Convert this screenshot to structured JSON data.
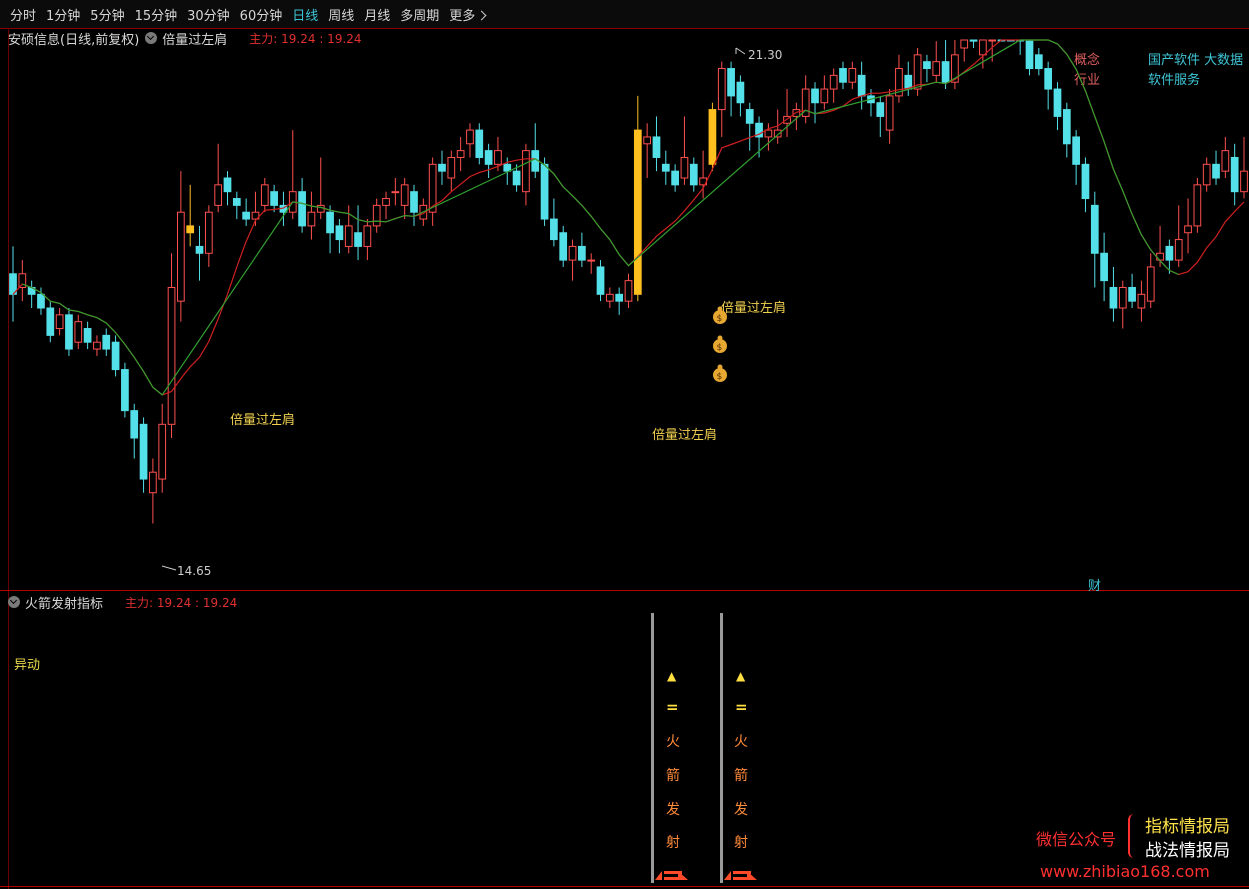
{
  "toolbar": {
    "tabs": [
      "分时",
      "1分钟",
      "5分钟",
      "15分钟",
      "30分钟",
      "60分钟",
      "日线",
      "周线",
      "月线",
      "多周期",
      "更多"
    ],
    "active_tab": "日线"
  },
  "header": {
    "stock": "安硕信息(日线,前复权)",
    "indicator": "倍量过左肩",
    "main_force": "主力: 19.24 : 19.24"
  },
  "info": {
    "concept_label": "概念",
    "concept_value": "国产软件 大数据 ",
    "industry_label": "行业",
    "industry_value": "软件服务"
  },
  "chart_labels": {
    "high": "21.30",
    "low": "14.65",
    "signal": "倍量过左肩",
    "cai": "财"
  },
  "sub": {
    "indicator": "火箭发射指标",
    "main_force": "主力: 19.24 : 19.24",
    "yidong": "异动",
    "rocket_chars": [
      "▲",
      "=",
      "火",
      "箭",
      "发",
      "射"
    ]
  },
  "watermark": {
    "wechat": "微信公众号",
    "brand1": "指标情报局",
    "brand2": "战法情报局",
    "url": "www.zhibiao168.com"
  },
  "colors": {
    "up": "#ff5050",
    "down": "#54e0e8",
    "ma_red": "#d02020",
    "ma_green": "#30a030",
    "signal_bar": "#ffc020",
    "signal_text": "#f0d050"
  },
  "chart_data": {
    "type": "candlestick",
    "ylim": [
      14.0,
      21.6
    ],
    "candles": [
      [
        18.3,
        18.0,
        18.7,
        17.6
      ],
      [
        18.1,
        18.3,
        18.5,
        17.9
      ],
      [
        18.1,
        18.0,
        18.2,
        17.8
      ],
      [
        18.0,
        17.8,
        18.1,
        17.7
      ],
      [
        17.8,
        17.4,
        17.9,
        17.3
      ],
      [
        17.5,
        17.7,
        17.8,
        17.4
      ],
      [
        17.7,
        17.2,
        17.8,
        17.1
      ],
      [
        17.3,
        17.6,
        17.7,
        17.2
      ],
      [
        17.5,
        17.3,
        17.6,
        17.2
      ],
      [
        17.2,
        17.3,
        17.4,
        17.1
      ],
      [
        17.4,
        17.2,
        17.5,
        17.1
      ],
      [
        17.3,
        16.9,
        17.4,
        16.8
      ],
      [
        16.9,
        16.3,
        17.0,
        16.2
      ],
      [
        16.3,
        15.9,
        16.4,
        15.6
      ],
      [
        16.1,
        15.3,
        16.2,
        15.1
      ],
      [
        15.1,
        15.4,
        15.6,
        14.65
      ],
      [
        15.3,
        16.1,
        16.4,
        15.1
      ],
      [
        16.1,
        18.1,
        18.6,
        15.9
      ],
      [
        17.9,
        19.2,
        19.8,
        17.6
      ],
      [
        18.9,
        19.0,
        19.6,
        18.7
      ],
      [
        18.7,
        18.6,
        19.0,
        18.2
      ],
      [
        18.6,
        19.2,
        19.3,
        18.4
      ],
      [
        19.3,
        19.6,
        20.2,
        19.2
      ],
      [
        19.7,
        19.5,
        19.8,
        19.3
      ],
      [
        19.4,
        19.3,
        19.5,
        19.1
      ],
      [
        19.2,
        19.1,
        19.4,
        19.0
      ],
      [
        19.1,
        19.2,
        19.5,
        19.0
      ],
      [
        19.3,
        19.6,
        19.7,
        19.2
      ],
      [
        19.5,
        19.3,
        19.6,
        19.2
      ],
      [
        19.3,
        19.2,
        19.5,
        19.0
      ],
      [
        19.2,
        19.5,
        20.4,
        19.1
      ],
      [
        19.5,
        19.0,
        19.7,
        18.9
      ],
      [
        19.0,
        19.2,
        19.5,
        18.8
      ],
      [
        19.2,
        19.3,
        20.0,
        19.1
      ],
      [
        19.2,
        18.9,
        19.3,
        18.6
      ],
      [
        19.0,
        18.8,
        19.1,
        18.6
      ],
      [
        18.7,
        19.0,
        19.3,
        18.6
      ],
      [
        18.9,
        18.7,
        19.3,
        18.5
      ],
      [
        18.7,
        19.0,
        19.1,
        18.5
      ],
      [
        19.0,
        19.3,
        19.4,
        18.9
      ],
      [
        19.3,
        19.4,
        19.5,
        19.1
      ],
      [
        19.5,
        19.5,
        19.7,
        19.3
      ],
      [
        19.3,
        19.6,
        19.7,
        19.1
      ],
      [
        19.5,
        19.2,
        19.6,
        19.0
      ],
      [
        19.1,
        19.3,
        19.4,
        19.0
      ],
      [
        19.2,
        19.9,
        20.0,
        19.0
      ],
      [
        19.9,
        19.8,
        20.1,
        19.6
      ],
      [
        19.7,
        20.0,
        20.1,
        19.5
      ],
      [
        20.0,
        20.1,
        20.3,
        19.8
      ],
      [
        20.2,
        20.4,
        20.5,
        20.0
      ],
      [
        20.4,
        20.0,
        20.5,
        19.9
      ],
      [
        20.1,
        19.9,
        20.2,
        19.7
      ],
      [
        19.9,
        20.1,
        20.3,
        19.8
      ],
      [
        19.9,
        19.8,
        20.0,
        19.6
      ],
      [
        19.8,
        19.6,
        19.9,
        19.5
      ],
      [
        19.5,
        20.1,
        20.2,
        19.3
      ],
      [
        20.1,
        19.8,
        20.5,
        19.7
      ],
      [
        19.9,
        19.1,
        20.0,
        19.0
      ],
      [
        19.1,
        18.8,
        19.4,
        18.7
      ],
      [
        18.9,
        18.5,
        19.0,
        18.4
      ],
      [
        18.5,
        18.7,
        18.8,
        18.2
      ],
      [
        18.7,
        18.5,
        18.9,
        18.4
      ],
      [
        18.5,
        18.5,
        18.6,
        18.3
      ],
      [
        18.4,
        18.0,
        18.5,
        17.9
      ],
      [
        17.9,
        18.0,
        18.1,
        17.8
      ],
      [
        18.0,
        17.9,
        18.1,
        17.7
      ],
      [
        17.9,
        18.2,
        18.3,
        17.8
      ],
      [
        18.0,
        20.4,
        20.9,
        17.9
      ],
      [
        20.2,
        20.3,
        20.5,
        19.7
      ],
      [
        20.3,
        20.0,
        20.6,
        19.8
      ],
      [
        19.9,
        19.8,
        20.1,
        19.6
      ],
      [
        19.8,
        19.6,
        19.9,
        19.5
      ],
      [
        19.7,
        20.0,
        20.6,
        19.6
      ],
      [
        19.9,
        19.6,
        20.0,
        19.5
      ],
      [
        19.6,
        19.7,
        20.1,
        19.4
      ],
      [
        19.9,
        20.7,
        20.8,
        19.8
      ],
      [
        20.7,
        21.3,
        21.4,
        20.3
      ],
      [
        21.3,
        20.9,
        21.4,
        20.6
      ],
      [
        21.1,
        20.8,
        21.2,
        20.6
      ],
      [
        20.7,
        20.5,
        20.8,
        20.1
      ],
      [
        20.5,
        20.3,
        20.6,
        20.0
      ],
      [
        20.3,
        20.4,
        20.5,
        20.1
      ],
      [
        20.3,
        20.4,
        20.7,
        20.2
      ],
      [
        20.5,
        20.6,
        21.0,
        20.3
      ],
      [
        20.6,
        20.7,
        20.8,
        20.4
      ],
      [
        20.6,
        21.0,
        21.2,
        20.5
      ],
      [
        21.0,
        20.8,
        21.1,
        20.5
      ],
      [
        20.8,
        21.0,
        21.2,
        20.7
      ],
      [
        21.0,
        21.2,
        21.3,
        20.8
      ],
      [
        21.3,
        21.1,
        21.4,
        21.0
      ],
      [
        21.1,
        21.3,
        21.4,
        21.0
      ],
      [
        21.2,
        20.9,
        21.4,
        20.7
      ],
      [
        20.9,
        20.8,
        21.0,
        20.6
      ],
      [
        20.8,
        20.6,
        20.9,
        20.3
      ],
      [
        20.4,
        20.9,
        21.0,
        20.2
      ],
      [
        20.9,
        21.3,
        21.5,
        20.8
      ],
      [
        21.2,
        21.0,
        21.4,
        20.9
      ],
      [
        21.0,
        21.5,
        21.6,
        20.9
      ],
      [
        21.4,
        21.3,
        21.5,
        21.1
      ],
      [
        21.2,
        21.4,
        21.7,
        21.1
      ],
      [
        21.4,
        21.1,
        21.8,
        21.0
      ],
      [
        21.1,
        21.5,
        22.0,
        21.0
      ],
      [
        21.6,
        21.9,
        22.4,
        21.4
      ],
      [
        21.8,
        21.7,
        22.5,
        21.6
      ],
      [
        21.5,
        22.1,
        22.4,
        21.3
      ],
      [
        21.9,
        22.6,
        22.7,
        21.4
      ],
      [
        22.5,
        22.3,
        22.8,
        22.1
      ],
      [
        22.4,
        21.9,
        22.7,
        21.8
      ],
      [
        21.9,
        21.8,
        22.2,
        21.5
      ],
      [
        21.7,
        21.3,
        21.8,
        21.2
      ],
      [
        21.5,
        21.3,
        21.6,
        21.2
      ],
      [
        21.3,
        21.0,
        21.4,
        20.7
      ],
      [
        21.0,
        20.6,
        21.1,
        20.4
      ],
      [
        20.7,
        20.2,
        20.8,
        20.0
      ],
      [
        20.3,
        19.9,
        20.4,
        19.6
      ],
      [
        19.9,
        19.4,
        20.0,
        19.2
      ],
      [
        19.3,
        18.6,
        19.5,
        18.1
      ],
      [
        18.6,
        18.2,
        18.9,
        17.9
      ],
      [
        18.1,
        17.8,
        18.4,
        17.6
      ],
      [
        17.8,
        18.1,
        18.2,
        17.5
      ],
      [
        18.1,
        17.9,
        18.3,
        17.8
      ],
      [
        17.8,
        18.0,
        18.2,
        17.6
      ],
      [
        17.9,
        18.4,
        18.6,
        17.8
      ],
      [
        18.5,
        18.6,
        19.0,
        18.4
      ],
      [
        18.7,
        18.5,
        18.8,
        18.3
      ],
      [
        18.5,
        18.8,
        19.3,
        18.4
      ],
      [
        18.9,
        19.0,
        19.4,
        18.6
      ],
      [
        19.0,
        19.6,
        19.7,
        18.9
      ],
      [
        19.6,
        19.9,
        20.0,
        19.5
      ],
      [
        19.9,
        19.7,
        20.1,
        19.6
      ],
      [
        19.8,
        20.1,
        20.3,
        19.7
      ],
      [
        20.0,
        19.5,
        20.2,
        19.3
      ],
      [
        19.5,
        19.8,
        20.3,
        19.4
      ]
    ]
  }
}
